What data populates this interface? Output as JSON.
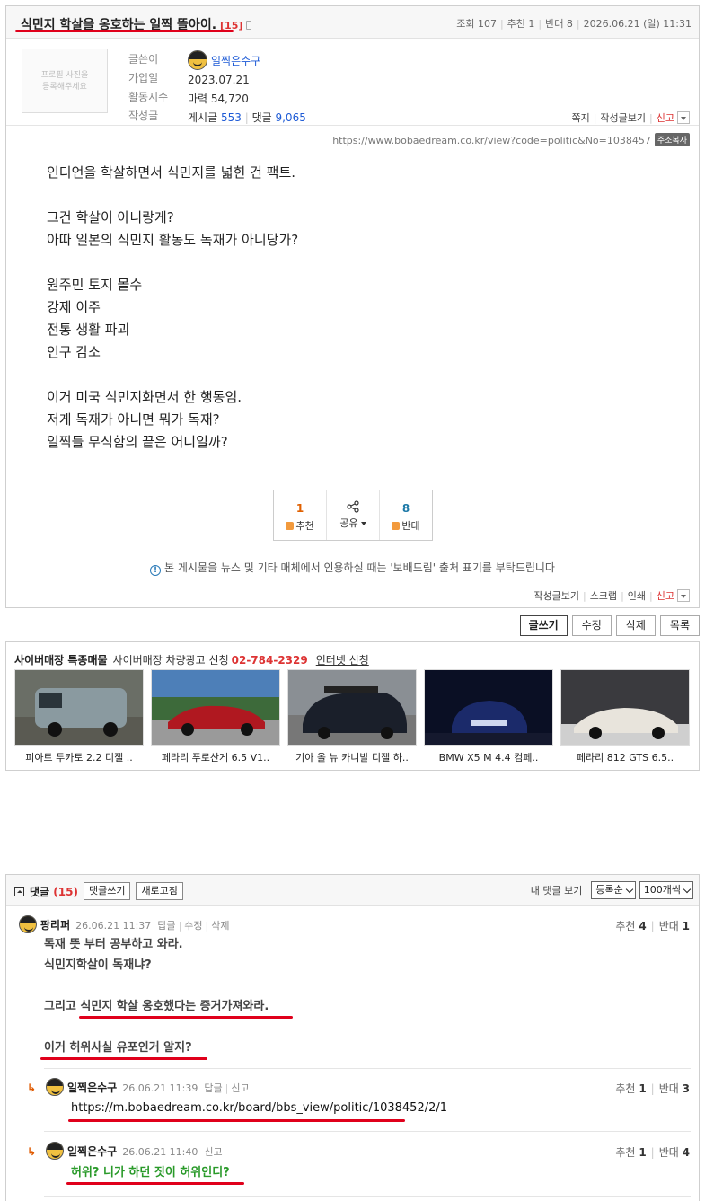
{
  "post": {
    "title": "식민지 학살을 옹호하는 일찍 뜰아이.",
    "comment_count": "[15]",
    "meta": {
      "views_label": "조회",
      "views": "107",
      "recommend_label": "추천",
      "recommend": "1",
      "oppose_label": "반대",
      "oppose": "8",
      "datetime": "2026.06.21 (일) 11:31"
    },
    "profile": {
      "photo_placeholder_line1": "프로필 사진을",
      "photo_placeholder_line2": "등록해주세요",
      "labels": [
        "글쓴이",
        "가입일",
        "활동지수",
        "작성글"
      ],
      "author": "일찍은수구",
      "join_date": "2023.07.21",
      "activity": "마력 54,720",
      "posts_label": "게시글",
      "posts_count": "553",
      "comments_label": "댓글",
      "comments_count": "9,065"
    },
    "profile_actions": [
      "쪽지",
      "작성글보기",
      "신고"
    ],
    "url": "https://www.bobaedream.co.kr/view?code=politic&No=1038457",
    "copy_label": "주소복사",
    "body": [
      "인디언을 학살하면서 식민지를 넓힌 건 팩트.",
      "",
      "그건 학살이 아니랑게?",
      "아따 일본의 식민지 활동도 독재가 아니당가?",
      "",
      "원주민 토지 몰수",
      "강제 이주",
      "전통 생활 파괴",
      "인구 감소",
      "",
      "이거 미국 식민지화면서 한 행동임.",
      "저게 독재가 아니면 뭐가 독재?",
      "일찍들 무식함의 끝은 어디일까?"
    ],
    "votes": {
      "up_count": "1",
      "up_label": "추천",
      "share_label": "공유",
      "down_count": "8",
      "down_label": "반대"
    },
    "notice": "본 게시물을 뉴스 및 기타 매체에서 인용하실 때는 '보배드림' 출처 표기를 부탁드립니다",
    "bottom_actions": [
      "작성글보기",
      "스크랩",
      "인쇄",
      "신고"
    ]
  },
  "buttons": {
    "write": "글쓰기",
    "edit": "수정",
    "delete": "삭제",
    "list": "목록"
  },
  "shop": {
    "title": "사이버매장 특종매물",
    "sub": "사이버매장 차량광고 신청",
    "phone": "02-784-2329",
    "apply": "인터넷 신청",
    "items": [
      {
        "name": "피아트 두카토 2.2 디젤 ..",
        "color": "#8a9aa0"
      },
      {
        "name": "페라리 푸로산게 6.5 V1..",
        "color": "#b01820"
      },
      {
        "name": "기아 올 뉴 카니발 디젤 하..",
        "color": "#1a1f2a"
      },
      {
        "name": "BMW X5 M 4.4 컴페..",
        "color": "#1b2a6a"
      },
      {
        "name": "페라리 812 GTS 6.5..",
        "color": "#e8e4dc"
      }
    ]
  },
  "comments_section": {
    "label": "댓글",
    "count": "(15)",
    "write_btn": "댓글쓰기",
    "refresh_btn": "새로고침",
    "my_comments": "내 댓글 보기",
    "sort": "등록순",
    "per_page": "100개씩"
  },
  "comments": [
    {
      "author": "팡리퍼",
      "time": "26.06.21 11:37",
      "actions": [
        "답글",
        "수정",
        "삭제"
      ],
      "rec_label": "추천",
      "rec": "4",
      "opp_label": "반대",
      "opp": "1",
      "lines": [
        "독재 뜻 부터 공부하고 와라.",
        "식민지학살이 독재냐?",
        "",
        "그리고 식민지 학살 옹호했다는 증거가져와라.",
        "",
        "이거 허위사실 유포인거 알지?"
      ]
    },
    {
      "author": "일찍은수구",
      "time": "26.06.21 11:39",
      "actions": [
        "답글",
        "신고"
      ],
      "rec_label": "추천",
      "rec": "1",
      "opp_label": "반대",
      "opp": "3",
      "lines": [
        "https://m.bobaedream.co.kr/board/bbs_view/politic/1038452/2/1"
      ]
    },
    {
      "author": "일찍은수구",
      "time": "26.06.21 11:40",
      "actions": [
        "신고"
      ],
      "rec_label": "추천",
      "rec": "1",
      "opp_label": "반대",
      "opp": "4",
      "lines": [
        "허위? 니가 하던 짓이 허위인디?"
      ]
    }
  ]
}
